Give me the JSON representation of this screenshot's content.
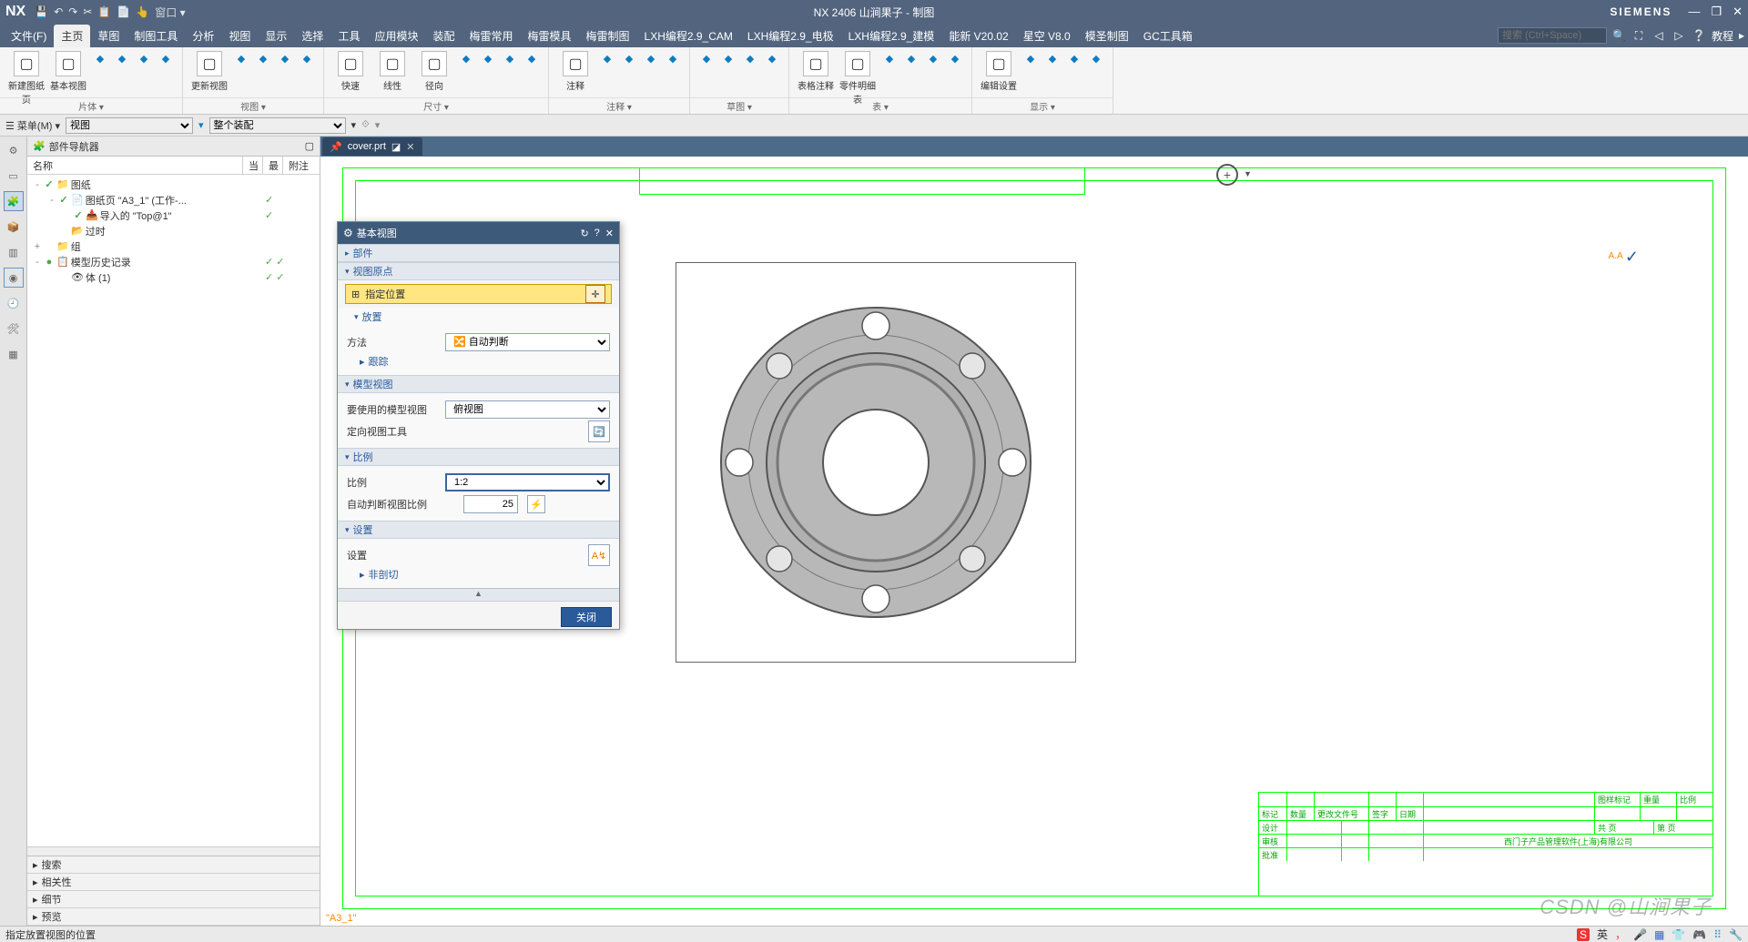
{
  "app": {
    "logo": "NX",
    "title": "NX 2406 山涧果子 - 制图",
    "brand": "SIEMENS"
  },
  "qat": {
    "window_menu": "窗口"
  },
  "win": {
    "min": "—",
    "max": "❐",
    "close": "✕"
  },
  "menu": {
    "items": [
      "文件(F)",
      "主页",
      "草图",
      "制图工具",
      "分析",
      "视图",
      "显示",
      "选择",
      "工具",
      "应用模块",
      "装配",
      "梅雷常用",
      "梅雷模具",
      "梅雷制图",
      "LXH编程2.9_CAM",
      "LXH编程2.9_电极",
      "LXH编程2.9_建模",
      "能新 V20.02",
      "星空 V8.0",
      "模圣制图",
      "GC工具箱"
    ],
    "active_index": 1,
    "search_placeholder": "搜索 (Ctrl+Space)",
    "tutorial": "教程"
  },
  "ribbon": {
    "groups": [
      {
        "label": "片体",
        "big": [
          {
            "t": "新建图纸页"
          },
          {
            "t": "基本视图"
          }
        ]
      },
      {
        "label": "视图",
        "big": [
          {
            "t": "更新视图"
          }
        ]
      },
      {
        "label": "尺寸",
        "big": [
          {
            "t": "快速"
          },
          {
            "t": "线性"
          },
          {
            "t": "径向"
          }
        ]
      },
      {
        "label": "注释",
        "big": [
          {
            "t": "注释"
          }
        ]
      },
      {
        "label": "草图"
      },
      {
        "label": "表",
        "big": [
          {
            "t": "表格注释"
          },
          {
            "t": "零件明细表"
          }
        ]
      },
      {
        "label": "显示",
        "big": [
          {
            "t": "编辑设置"
          }
        ]
      }
    ]
  },
  "filter": {
    "menu": "菜单(M)",
    "sel1": "视图",
    "sel2": "整个装配"
  },
  "nav": {
    "title": "部件导航器",
    "cols": {
      "c1": "名称",
      "c2": "当",
      "c3": "最",
      "c4": "附注"
    },
    "tree": [
      {
        "ind": 0,
        "exp": "-",
        "chk": "✓",
        "ico": "📁",
        "name": "图纸",
        "m": ""
      },
      {
        "ind": 1,
        "exp": "-",
        "chk": "✓",
        "ico": "📄",
        "name": "图纸页 \"A3_1\" (工作-...",
        "m": "✓"
      },
      {
        "ind": 2,
        "exp": "",
        "chk": "✓",
        "ico": "📥",
        "name": "导入的 \"Top@1\"",
        "m": "✓"
      },
      {
        "ind": 1,
        "exp": "",
        "chk": "",
        "ico": "📂",
        "name": "过时",
        "m": ""
      },
      {
        "ind": 0,
        "exp": "+",
        "chk": "",
        "ico": "📁",
        "name": "组",
        "m": ""
      },
      {
        "ind": 0,
        "exp": "-",
        "chk": "●",
        "ico": "📋",
        "name": "模型历史记录",
        "m": "✓ ✓"
      },
      {
        "ind": 1,
        "exp": "",
        "chk": "",
        "ico": "👁",
        "name": "体 (1)",
        "m": "✓ ✓"
      }
    ],
    "accordion": [
      "搜索",
      "相关性",
      "细节",
      "预览"
    ]
  },
  "doc": {
    "tab": "cover.prt",
    "pin": "📌"
  },
  "dialog": {
    "title": "基本视图",
    "sec_component": "部件",
    "sec_origin": "视图原点",
    "specify_loc": "指定位置",
    "sec_place": "放置",
    "method_label": "方法",
    "method_value": "自动判断",
    "track": "跟踪",
    "sec_modelview": "模型视图",
    "mv_label": "要使用的模型视图",
    "mv_value": "俯视图",
    "orient_tool": "定向视图工具",
    "sec_scale": "比例",
    "scale_label": "比例",
    "scale_value": "1:2",
    "auto_label": "自动判断视图比例",
    "auto_value": "25",
    "sec_settings": "设置",
    "settings_label": "设置",
    "non_section": "非剖切",
    "close": "关闭"
  },
  "sheet": {
    "label": "\"A3_1\"",
    "tb": {
      "mark": "标记",
      "qty": "数量",
      "file": "更改文件号",
      "sign": "签字",
      "date": "日期",
      "design": "设计",
      "check": "审核",
      "approve": "批准",
      "corp": "西门子产品管理软件(上海)有限公司",
      "partmark": "图样标记",
      "weight": "重量",
      "scale": "比例",
      "sheet": "共  页",
      "page": "第  页"
    }
  },
  "status": {
    "msg": "指定放置视图的位置",
    "ime_label": "英"
  },
  "watermark": "CSDN @山涧果子"
}
